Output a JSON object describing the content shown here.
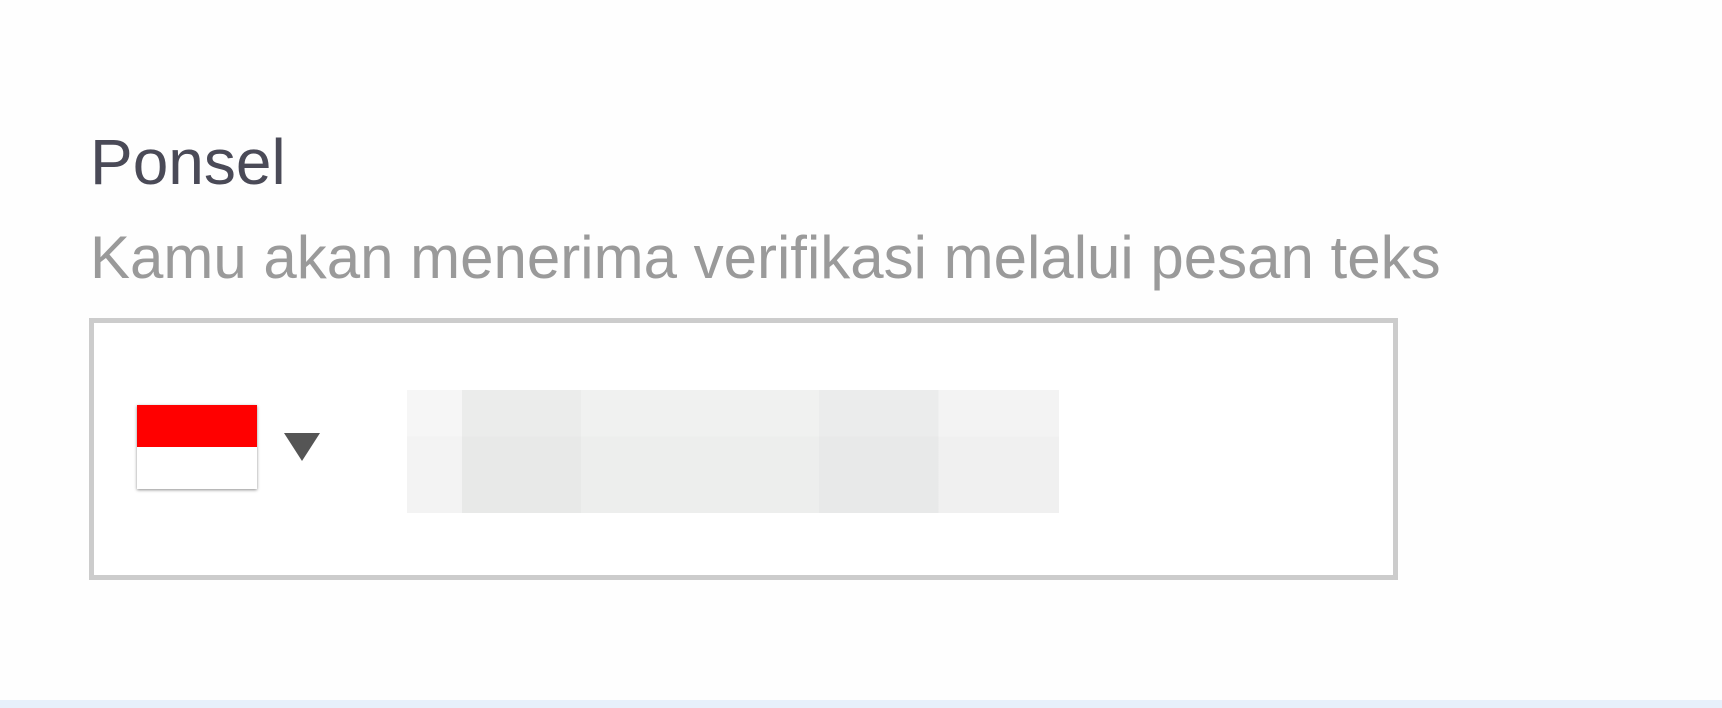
{
  "phone_field": {
    "label": "Ponsel",
    "hint": "Kamu akan menerima verifikasi melalui pesan teks",
    "country_select": {
      "flag_icon": "indonesia-flag-icon",
      "flag_colors": [
        "#ff0000",
        "#ffffff"
      ],
      "dropdown_icon": "caret-down-icon"
    },
    "number_input": {
      "value": "",
      "placeholder": ""
    }
  },
  "colors": {
    "label": "#4a4a57",
    "hint": "#9a9a9a",
    "box_border": "#cccccc",
    "caret": "#555555"
  }
}
